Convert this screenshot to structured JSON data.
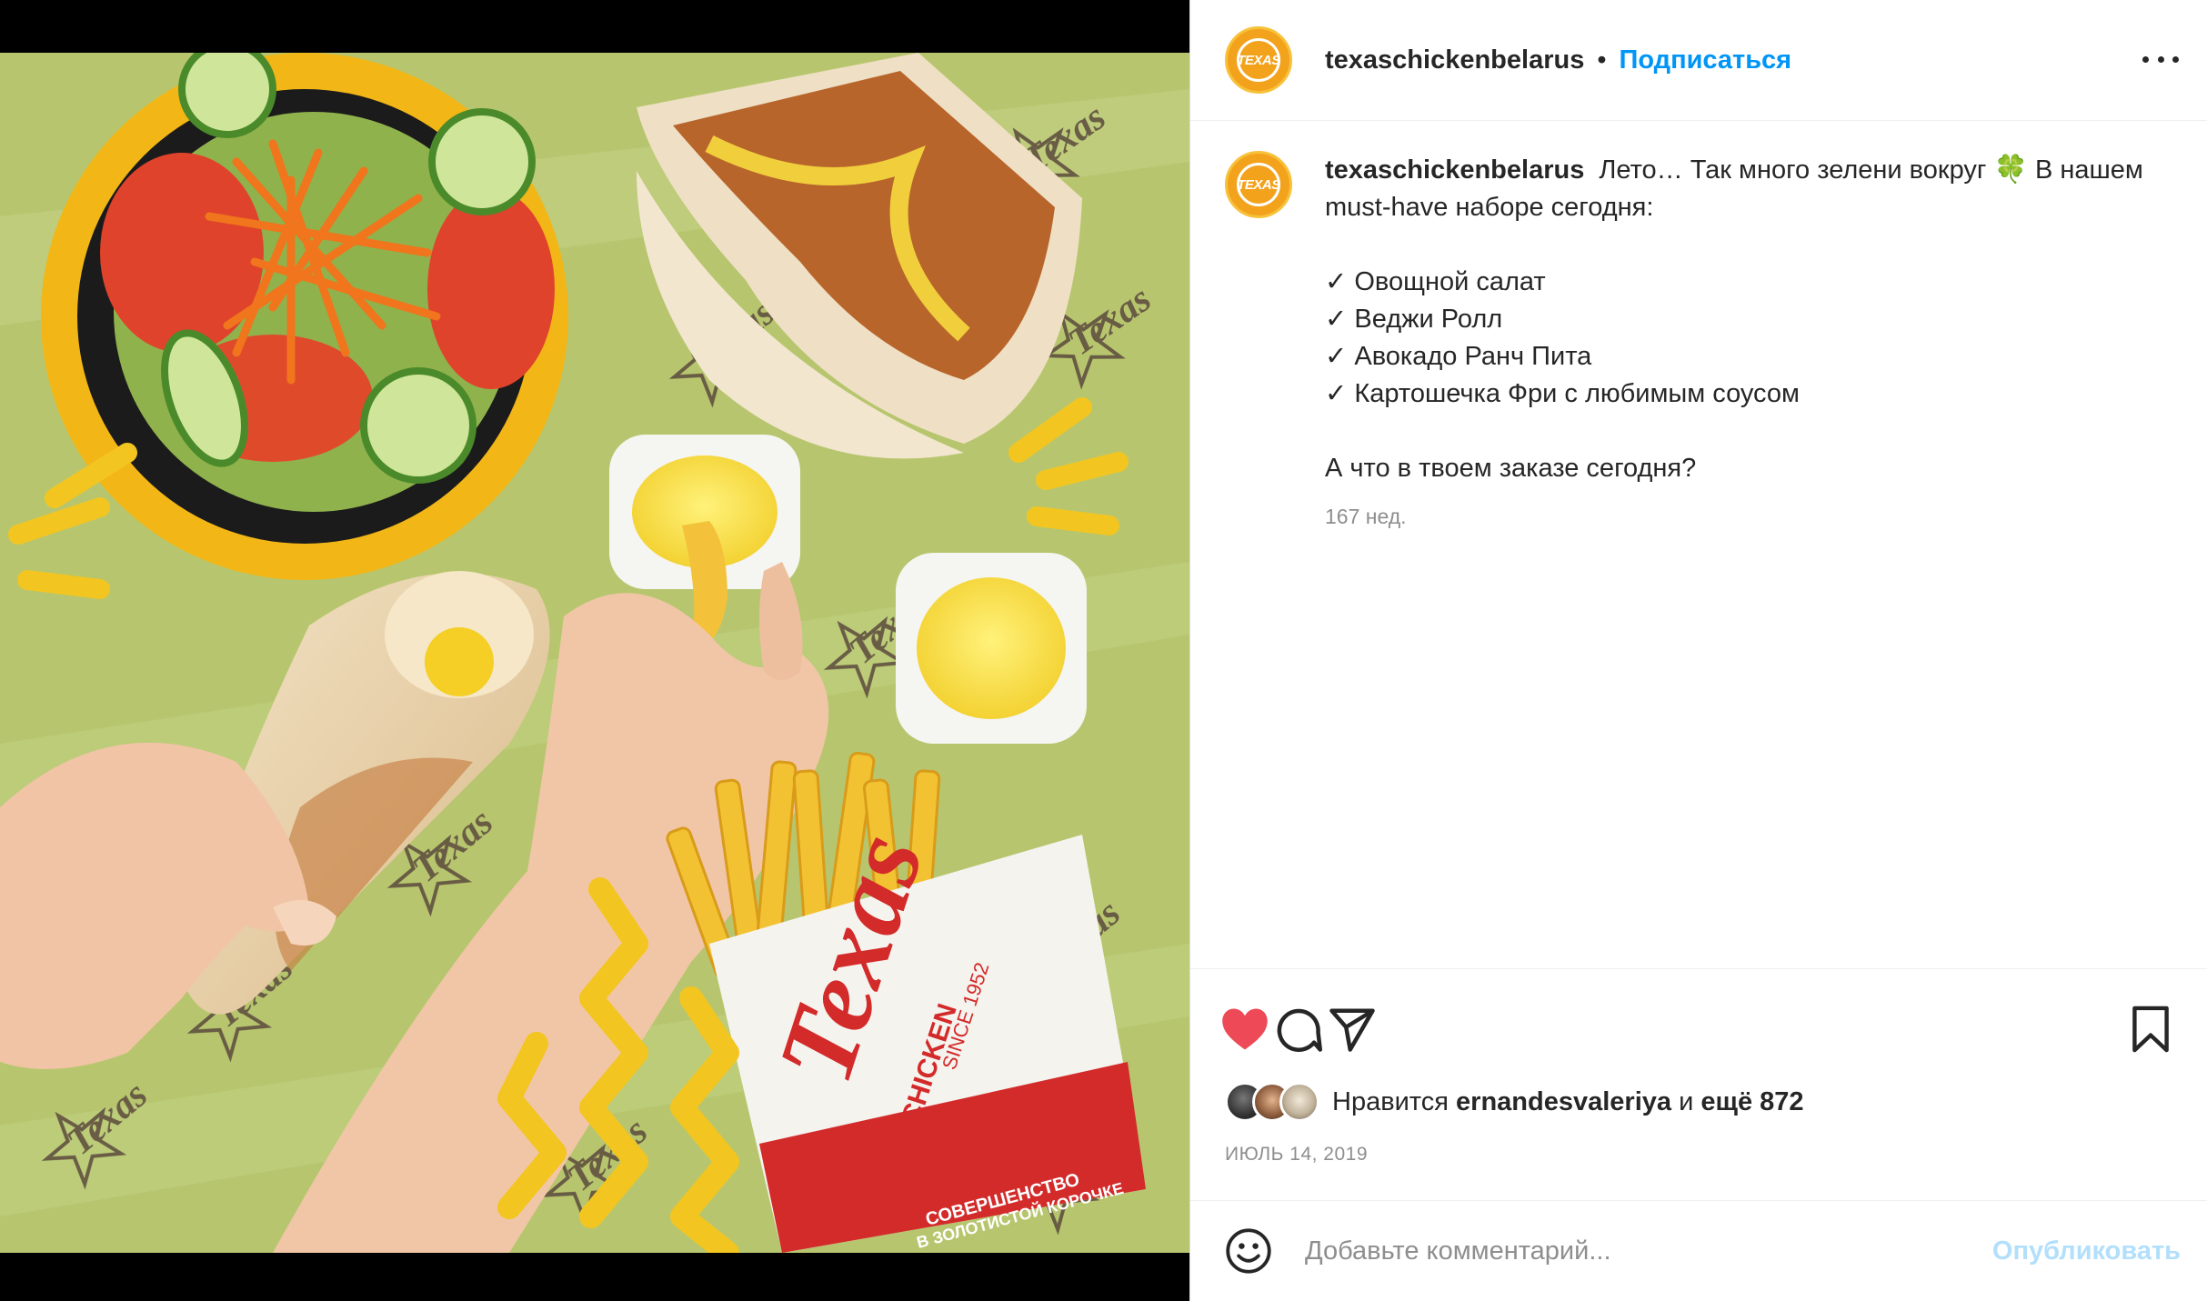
{
  "post": {
    "author": "texaschickenbelarus",
    "follow_label": "Подписаться",
    "dot": "•",
    "avatar_logo_text": "TEXAS",
    "caption": {
      "username": "texaschickenbelarus",
      "intro": "Лето… Так много зелени вокруг",
      "emoji": "🍀",
      "intro_end": "В нашем must-have наборе сегодня:",
      "items": [
        "✓ Овощной салат",
        "✓ Веджи Ролл",
        "✓ Авокадо Ранч Пита",
        "✓ Картошечка Фри с любимым соусом"
      ],
      "question": "А что в твоем заказе сегодня?",
      "time_ago": "167 нед."
    },
    "likes": {
      "prefix": "Нравится",
      "user": "ernandesvaleriya",
      "conj": "и",
      "others": "ещё 872"
    },
    "date": "ИЮЛЬ 14, 2019",
    "comment": {
      "placeholder": "Добавьте комментарий...",
      "publish": "Опубликовать"
    },
    "photo_text": {
      "box_brand": "Texas",
      "box_sub": "CHICKEN",
      "box_since": "SINCE 1952",
      "box_slogan_1": "СОВЕРШЕНСТВО",
      "box_slogan_2": "В ЗОЛОТИСТОЙ КОРОЧКЕ",
      "pattern_brand": "Texas",
      "pattern_sub": "CHICKEN"
    },
    "colors": {
      "accent_blue": "#0095f6",
      "like_red": "#ed4956",
      "brand_orange": "#f3a21c",
      "brand_red": "#d32a2a",
      "background_green": "#b3c46a"
    },
    "icons": [
      "heart-icon",
      "comment-icon",
      "share-icon",
      "bookmark-icon",
      "more-icon",
      "emoji-icon"
    ]
  }
}
